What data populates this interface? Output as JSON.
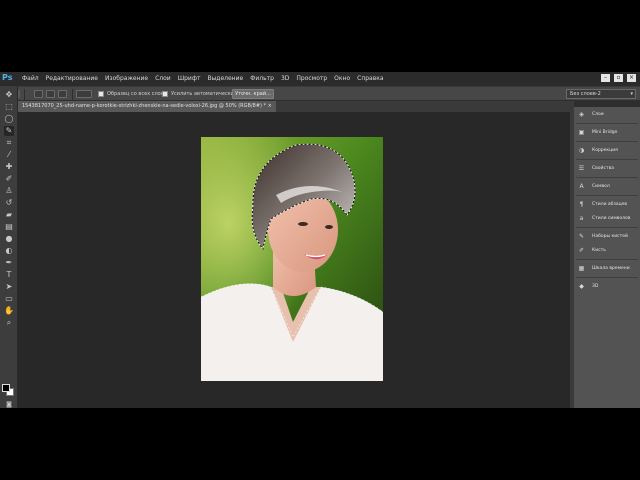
{
  "app": {
    "logo": "Ps"
  },
  "menubar": {
    "items": [
      "Файл",
      "Редактирование",
      "Изображение",
      "Слои",
      "Шрифт",
      "Выделение",
      "Фильтр",
      "3D",
      "Просмотр",
      "Окно",
      "Справка"
    ]
  },
  "options_bar": {
    "sample_all_layers": "Образец со всех слоев",
    "auto_enhance": "Усилить автоматически",
    "refine_edge": "Уточн. край...",
    "workspace": "Без слоев-2"
  },
  "document": {
    "tab_title": "1543817070_25-uhd-name-p-korotkie-strizhki-zhenskie-na-sedie-volosi-26.jpg @ 50% (RGB/8#) *"
  },
  "panels": [
    {
      "icon": "layers-icon",
      "label": "Слои"
    },
    {
      "icon": "mini-bridge-icon",
      "label": "Mini Bridge"
    },
    {
      "icon": "adjustments-icon",
      "label": "Коррекция"
    },
    {
      "icon": "properties-icon",
      "label": "Свойства"
    },
    {
      "icon": "character-icon",
      "label": "Символ"
    },
    {
      "icon": "paragraph-styles-icon",
      "label": "Стили абзацев"
    },
    {
      "icon": "character-styles-icon",
      "label": "Стили символов"
    },
    {
      "icon": "brush-presets-icon",
      "label": "Наборы кистей"
    },
    {
      "icon": "brush-icon",
      "label": "Кисть"
    },
    {
      "icon": "history-icon",
      "label": "Шкала времени"
    },
    {
      "icon": "3d-icon",
      "label": "3D"
    }
  ],
  "tools": [
    "move-tool-icon",
    "marquee-tool-icon",
    "lasso-tool-icon",
    "quick-selection-tool-icon",
    "crop-tool-icon",
    "eyedropper-tool-icon",
    "healing-brush-tool-icon",
    "brush-tool-icon",
    "clone-stamp-tool-icon",
    "history-brush-tool-icon",
    "eraser-tool-icon",
    "gradient-tool-icon",
    "blur-tool-icon",
    "dodge-tool-icon",
    "pen-tool-icon",
    "type-tool-icon",
    "path-selection-tool-icon",
    "shape-tool-icon",
    "hand-tool-icon",
    "zoom-tool-icon"
  ],
  "colors": {
    "foreground": "#000000",
    "background": "#ffffff",
    "accent": "#4fb3ea"
  }
}
